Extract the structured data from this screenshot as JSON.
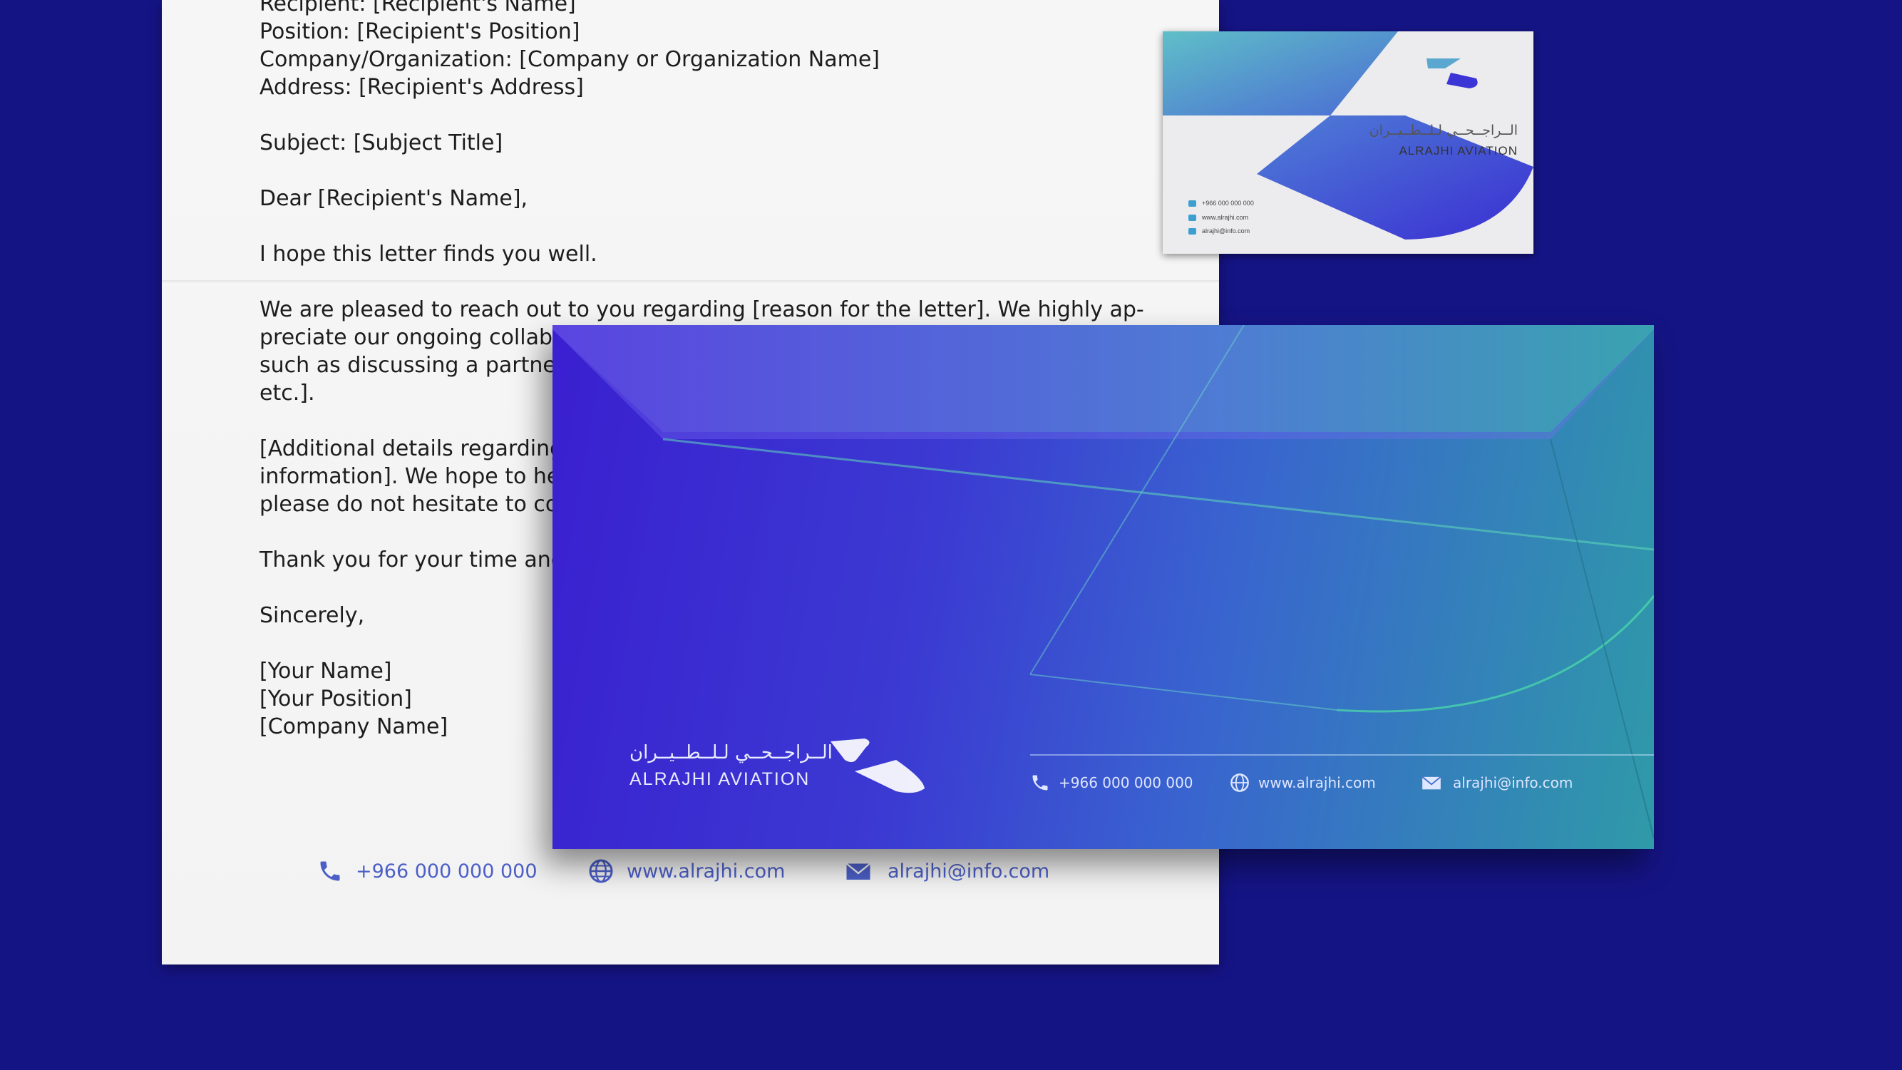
{
  "letter": {
    "lines": [
      "Recipient: [Recipient's Name]",
      "Position: [Recipient's Position]",
      "Company/Organization: [Company or Organization Name]",
      "Address: [Recipient's Address]",
      "",
      "Subject: [Subject Title]",
      "",
      "Dear [Recipient's Name],",
      "",
      "I hope this letter finds you well.",
      "",
      "We are pleased to reach out to you regarding [reason for the letter]. We highly ap-",
      "preciate our ongoing collabo",
      "such as discussing a partners",
      "etc.].",
      "",
      "[Additional details regarding",
      "information]. We hope to hea",
      "please do not hesitate to con",
      "",
      "Thank you for your time and",
      "",
      "Sincerely,",
      "",
      "[Your Name]",
      "[Your Position]",
      "[Company Name]"
    ],
    "footer": {
      "phone": "+966 000 000 000",
      "web": "www.alrajhi.com",
      "email": "alrajhi@info.com"
    }
  },
  "card": {
    "brand_arabic": "الــراجــحــي لـلــطــيــران",
    "brand": "ALRAJHI AVIATION",
    "phone": "+966 000 000 000",
    "web": "www.alrajhi.com",
    "email": "alrajhi@info.com"
  },
  "envelope": {
    "brand_arabic": "الــراجــحــي لـلــطــيــران",
    "brand": "ALRAJHI AVIATION",
    "phone": "+966 000 000 000",
    "web": "www.alrajhi.com",
    "email": "alrajhi@info.com"
  },
  "colors": {
    "background": "#151485",
    "accent_blue": "#4c5fc7",
    "teal": "#2f9aa8",
    "violet": "#3a1fd0"
  }
}
